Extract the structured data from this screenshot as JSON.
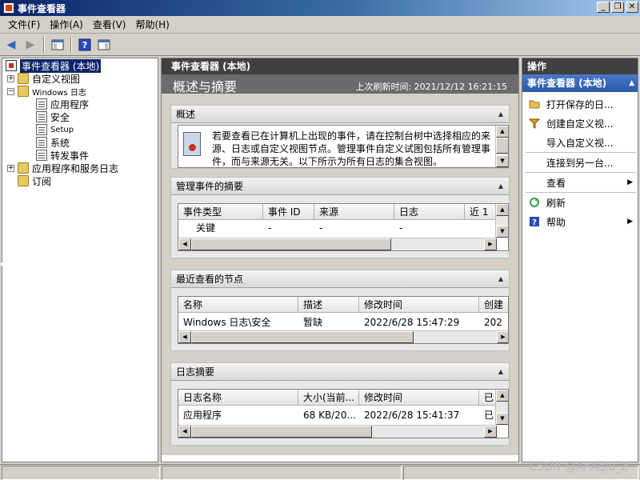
{
  "window": {
    "title": "事件查看器"
  },
  "menu": [
    "文件(F)",
    "操作(A)",
    "查看(V)",
    "帮助(H)"
  ],
  "tree": {
    "root": "事件查看器 (本地)",
    "custom_views": "自定义视图",
    "windows_logs": "Windows 日志",
    "logs": [
      "应用程序",
      "安全",
      "Setup",
      "系统",
      "转发事件"
    ],
    "app_services": "应用程序和服务日志",
    "subscriptions": "订阅"
  },
  "center": {
    "header": "事件查看器 (本地)",
    "subtitle": "概述与摘要",
    "last_refresh": "上次刷新时间: 2021/12/12 16:21:15",
    "overview": {
      "title": "概述",
      "text": "若要查看已在计算机上出现的事件，请在控制台树中选择相应的来源、日志或自定义视图节点。管理事件自定义试图包括所有管理事件，而与来源无关。以下所示为所有日志的集合视图。"
    },
    "admin_summary": {
      "title": "管理事件的摘要",
      "columns": [
        "事件类型",
        "事件 ID",
        "来源",
        "日志",
        "近 1"
      ],
      "rows": [
        [
          "关键",
          "-",
          "-",
          "-",
          ""
        ]
      ]
    },
    "recent_nodes": {
      "title": "最近查看的节点",
      "columns": [
        "名称",
        "描述",
        "修改时间",
        "创建"
      ],
      "rows": [
        [
          "Windows 日志\\安全",
          "暂缺",
          "2022/6/28 15:47:29",
          "202"
        ]
      ]
    },
    "log_summary": {
      "title": "日志摘要",
      "columns": [
        "日志名称",
        "大小(当前...",
        "修改时间",
        "已"
      ],
      "rows": [
        [
          "应用程序",
          "68 KB/20...",
          "2022/6/28 15:41:37",
          "已"
        ]
      ]
    }
  },
  "actions": {
    "title": "操作",
    "group": "事件查看器 (本地)",
    "items": [
      {
        "label": "打开保存的日...",
        "icon": "folder-open-icon"
      },
      {
        "label": "创建自定义视...",
        "icon": "filter-icon"
      },
      {
        "label": "导入自定义视...",
        "icon": ""
      },
      {
        "label": "连接到另一台...",
        "icon": ""
      },
      {
        "label": "查看",
        "icon": ""
      },
      {
        "label": "刷新",
        "icon": "refresh-icon"
      },
      {
        "label": "帮助",
        "icon": "help-icon"
      }
    ]
  },
  "watermark": "CSDN @AnAqiu_Z"
}
